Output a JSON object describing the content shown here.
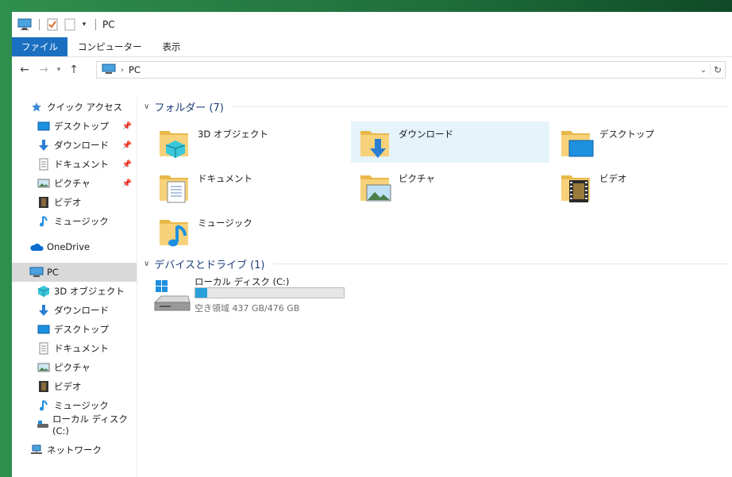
{
  "window": {
    "title": "PC"
  },
  "ribbon": {
    "tabs": [
      "ファイル",
      "コンピューター",
      "表示"
    ]
  },
  "address": {
    "path": "PC"
  },
  "sidebar": {
    "quick_access": "クイック アクセス",
    "quick_items": [
      {
        "label": "デスクトップ",
        "icon": "desktop-icon",
        "pinned": true
      },
      {
        "label": "ダウンロード",
        "icon": "download-icon",
        "pinned": true
      },
      {
        "label": "ドキュメント",
        "icon": "document-icon",
        "pinned": true
      },
      {
        "label": "ピクチャ",
        "icon": "picture-icon",
        "pinned": true
      },
      {
        "label": "ビデオ",
        "icon": "video-icon",
        "pinned": false
      },
      {
        "label": "ミュージック",
        "icon": "music-icon",
        "pinned": false
      }
    ],
    "onedrive": "OneDrive",
    "pc": "PC",
    "pc_items": [
      {
        "label": "3D オブジェクト",
        "icon": "3d-object-icon"
      },
      {
        "label": "ダウンロード",
        "icon": "download-icon"
      },
      {
        "label": "デスクトップ",
        "icon": "desktop-icon"
      },
      {
        "label": "ドキュメント",
        "icon": "document-icon"
      },
      {
        "label": "ピクチャ",
        "icon": "picture-icon"
      },
      {
        "label": "ビデオ",
        "icon": "video-icon"
      },
      {
        "label": "ミュージック",
        "icon": "music-icon"
      },
      {
        "label": "ローカル ディスク (C:)",
        "icon": "local-disk-icon"
      }
    ],
    "network": "ネットワーク"
  },
  "main": {
    "folders_header": "フォルダー (7)",
    "folders": [
      {
        "label": "3D オブジェクト",
        "icon": "3d-object-folder-icon"
      },
      {
        "label": "ダウンロード",
        "icon": "download-folder-icon"
      },
      {
        "label": "デスクトップ",
        "icon": "desktop-folder-icon"
      },
      {
        "label": "ドキュメント",
        "icon": "document-folder-icon"
      },
      {
        "label": "ピクチャ",
        "icon": "picture-folder-icon"
      },
      {
        "label": "ビデオ",
        "icon": "video-folder-icon"
      },
      {
        "label": "ミュージック",
        "icon": "music-folder-icon"
      }
    ],
    "devices_header": "デバイスとドライブ (1)",
    "drive": {
      "name": "ローカル ディスク (C:)",
      "free_text": "空き領域 437 GB/476 GB",
      "used_fraction": 0.082
    }
  },
  "colors": {
    "accent": "#1a6fc1",
    "drive_bar": "#26a0da",
    "selection": "#e5f3fb",
    "group_header": "#1e3d7a"
  }
}
